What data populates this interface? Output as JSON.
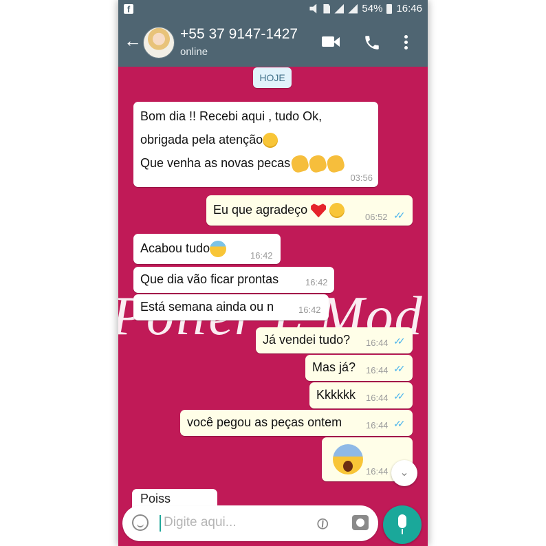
{
  "statusbar": {
    "battery": "54%",
    "time": "16:46"
  },
  "header": {
    "contact": "+55 37 9147-1427",
    "status": "online",
    "icons": [
      "back-arrow-icon",
      "video-call-icon",
      "phone-call-icon",
      "more-options-icon"
    ]
  },
  "watermark": "Poller L Mod",
  "day_label": "HOJE",
  "messages": [
    {
      "dir": "in",
      "lines": [
        "Bom dia !! Recebi aqui , tudo Ok,",
        "obrigada pela atenção",
        "Que venha as novas pecas"
      ],
      "time": "03:56"
    },
    {
      "dir": "out",
      "text": "Eu que agradeço",
      "time": "06:52"
    },
    {
      "dir": "in",
      "text": "Acabou tudo",
      "time": "16:42"
    },
    {
      "dir": "in",
      "text": "Que dia vão ficar prontas",
      "time": "16:42"
    },
    {
      "dir": "in",
      "text": "Está semana ainda ou n",
      "time": "16:42"
    },
    {
      "dir": "out",
      "text": "Já vendei tudo?",
      "time": "16:44"
    },
    {
      "dir": "out",
      "text": "Mas já?",
      "time": "16:44"
    },
    {
      "dir": "out",
      "text": "Kkkkkk",
      "time": "16:44"
    },
    {
      "dir": "out",
      "text": "você pegou as peças ontem",
      "time": "16:44"
    },
    {
      "dir": "out",
      "text": "",
      "emoji": "scream-emoji",
      "time": "16:44"
    },
    {
      "dir": "in",
      "text": "Poiss",
      "partial": true
    }
  ],
  "input": {
    "placeholder": "Digite aqui..."
  },
  "colors": {
    "header": "#4f6572",
    "chat_bg": "#c01a57",
    "incoming": "#ffffff",
    "outgoing": "#fffee8",
    "mic": "#1aa89a",
    "ticks": "#4fb6ec"
  }
}
